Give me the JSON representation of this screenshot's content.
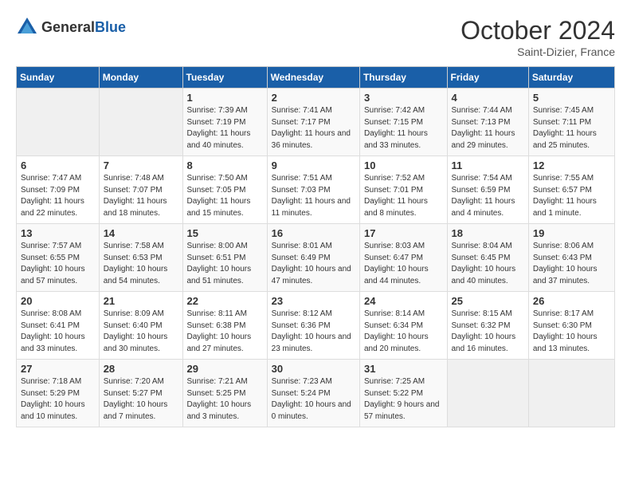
{
  "header": {
    "logo_general": "General",
    "logo_blue": "Blue",
    "month_year": "October 2024",
    "location": "Saint-Dizier, France"
  },
  "weekdays": [
    "Sunday",
    "Monday",
    "Tuesday",
    "Wednesday",
    "Thursday",
    "Friday",
    "Saturday"
  ],
  "weeks": [
    [
      {
        "day": "",
        "info": ""
      },
      {
        "day": "",
        "info": ""
      },
      {
        "day": "1",
        "info": "Sunrise: 7:39 AM\nSunset: 7:19 PM\nDaylight: 11 hours and 40 minutes."
      },
      {
        "day": "2",
        "info": "Sunrise: 7:41 AM\nSunset: 7:17 PM\nDaylight: 11 hours and 36 minutes."
      },
      {
        "day": "3",
        "info": "Sunrise: 7:42 AM\nSunset: 7:15 PM\nDaylight: 11 hours and 33 minutes."
      },
      {
        "day": "4",
        "info": "Sunrise: 7:44 AM\nSunset: 7:13 PM\nDaylight: 11 hours and 29 minutes."
      },
      {
        "day": "5",
        "info": "Sunrise: 7:45 AM\nSunset: 7:11 PM\nDaylight: 11 hours and 25 minutes."
      }
    ],
    [
      {
        "day": "6",
        "info": "Sunrise: 7:47 AM\nSunset: 7:09 PM\nDaylight: 11 hours and 22 minutes."
      },
      {
        "day": "7",
        "info": "Sunrise: 7:48 AM\nSunset: 7:07 PM\nDaylight: 11 hours and 18 minutes."
      },
      {
        "day": "8",
        "info": "Sunrise: 7:50 AM\nSunset: 7:05 PM\nDaylight: 11 hours and 15 minutes."
      },
      {
        "day": "9",
        "info": "Sunrise: 7:51 AM\nSunset: 7:03 PM\nDaylight: 11 hours and 11 minutes."
      },
      {
        "day": "10",
        "info": "Sunrise: 7:52 AM\nSunset: 7:01 PM\nDaylight: 11 hours and 8 minutes."
      },
      {
        "day": "11",
        "info": "Sunrise: 7:54 AM\nSunset: 6:59 PM\nDaylight: 11 hours and 4 minutes."
      },
      {
        "day": "12",
        "info": "Sunrise: 7:55 AM\nSunset: 6:57 PM\nDaylight: 11 hours and 1 minute."
      }
    ],
    [
      {
        "day": "13",
        "info": "Sunrise: 7:57 AM\nSunset: 6:55 PM\nDaylight: 10 hours and 57 minutes."
      },
      {
        "day": "14",
        "info": "Sunrise: 7:58 AM\nSunset: 6:53 PM\nDaylight: 10 hours and 54 minutes."
      },
      {
        "day": "15",
        "info": "Sunrise: 8:00 AM\nSunset: 6:51 PM\nDaylight: 10 hours and 51 minutes."
      },
      {
        "day": "16",
        "info": "Sunrise: 8:01 AM\nSunset: 6:49 PM\nDaylight: 10 hours and 47 minutes."
      },
      {
        "day": "17",
        "info": "Sunrise: 8:03 AM\nSunset: 6:47 PM\nDaylight: 10 hours and 44 minutes."
      },
      {
        "day": "18",
        "info": "Sunrise: 8:04 AM\nSunset: 6:45 PM\nDaylight: 10 hours and 40 minutes."
      },
      {
        "day": "19",
        "info": "Sunrise: 8:06 AM\nSunset: 6:43 PM\nDaylight: 10 hours and 37 minutes."
      }
    ],
    [
      {
        "day": "20",
        "info": "Sunrise: 8:08 AM\nSunset: 6:41 PM\nDaylight: 10 hours and 33 minutes."
      },
      {
        "day": "21",
        "info": "Sunrise: 8:09 AM\nSunset: 6:40 PM\nDaylight: 10 hours and 30 minutes."
      },
      {
        "day": "22",
        "info": "Sunrise: 8:11 AM\nSunset: 6:38 PM\nDaylight: 10 hours and 27 minutes."
      },
      {
        "day": "23",
        "info": "Sunrise: 8:12 AM\nSunset: 6:36 PM\nDaylight: 10 hours and 23 minutes."
      },
      {
        "day": "24",
        "info": "Sunrise: 8:14 AM\nSunset: 6:34 PM\nDaylight: 10 hours and 20 minutes."
      },
      {
        "day": "25",
        "info": "Sunrise: 8:15 AM\nSunset: 6:32 PM\nDaylight: 10 hours and 16 minutes."
      },
      {
        "day": "26",
        "info": "Sunrise: 8:17 AM\nSunset: 6:30 PM\nDaylight: 10 hours and 13 minutes."
      }
    ],
    [
      {
        "day": "27",
        "info": "Sunrise: 7:18 AM\nSunset: 5:29 PM\nDaylight: 10 hours and 10 minutes."
      },
      {
        "day": "28",
        "info": "Sunrise: 7:20 AM\nSunset: 5:27 PM\nDaylight: 10 hours and 7 minutes."
      },
      {
        "day": "29",
        "info": "Sunrise: 7:21 AM\nSunset: 5:25 PM\nDaylight: 10 hours and 3 minutes."
      },
      {
        "day": "30",
        "info": "Sunrise: 7:23 AM\nSunset: 5:24 PM\nDaylight: 10 hours and 0 minutes."
      },
      {
        "day": "31",
        "info": "Sunrise: 7:25 AM\nSunset: 5:22 PM\nDaylight: 9 hours and 57 minutes."
      },
      {
        "day": "",
        "info": ""
      },
      {
        "day": "",
        "info": ""
      }
    ]
  ]
}
